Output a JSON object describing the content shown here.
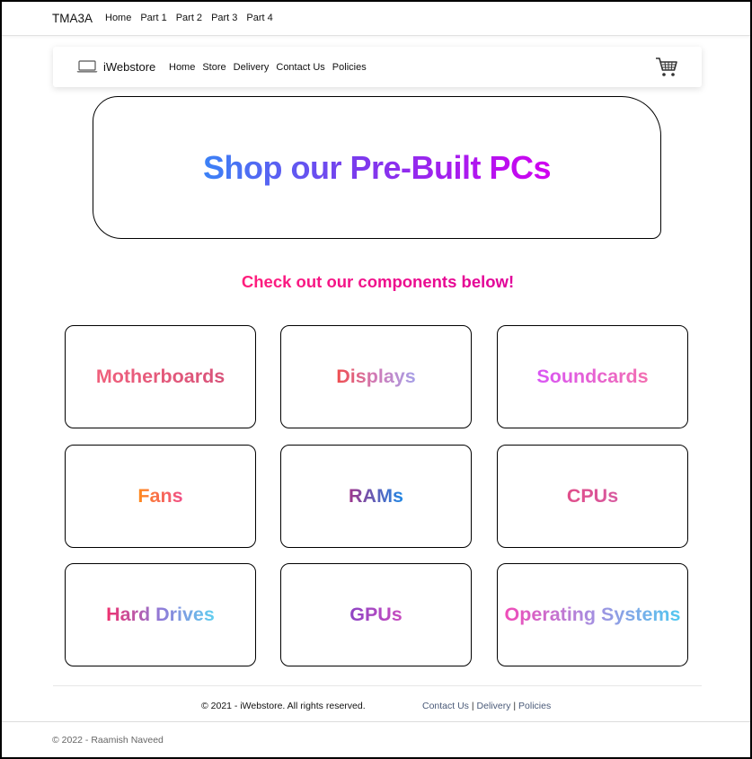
{
  "topnav": {
    "brand": "TMA3A",
    "links": [
      "Home",
      "Part 1",
      "Part 2",
      "Part 3",
      "Part 4"
    ]
  },
  "storenav": {
    "brand": "iWebstore",
    "links": [
      "Home",
      "Store",
      "Delivery",
      "Contact Us",
      "Policies"
    ],
    "icons": {
      "brand": "laptop-icon",
      "cart": "cart-icon"
    }
  },
  "hero": {
    "title": "Shop our Pre-Built PCs"
  },
  "subtitle": "Check out our components below!",
  "categories": [
    "Motherboards",
    "Displays",
    "Soundcards",
    "Fans",
    "RAMs",
    "CPUs",
    "Hard Drives",
    "GPUs",
    "Operating Systems"
  ],
  "footer": {
    "copyright": "© 2021 - iWebstore. All rights reserved.",
    "links": [
      "Contact Us",
      "Delivery",
      "Policies"
    ],
    "separator": "|"
  },
  "page_footer": {
    "copyright": "© 2022 - Raamish Naveed"
  },
  "colors": {
    "hero_gradient": [
      "#3b82f6",
      "#7c3aed",
      "#d100f0"
    ],
    "subtitle": "#ff1f7c"
  }
}
